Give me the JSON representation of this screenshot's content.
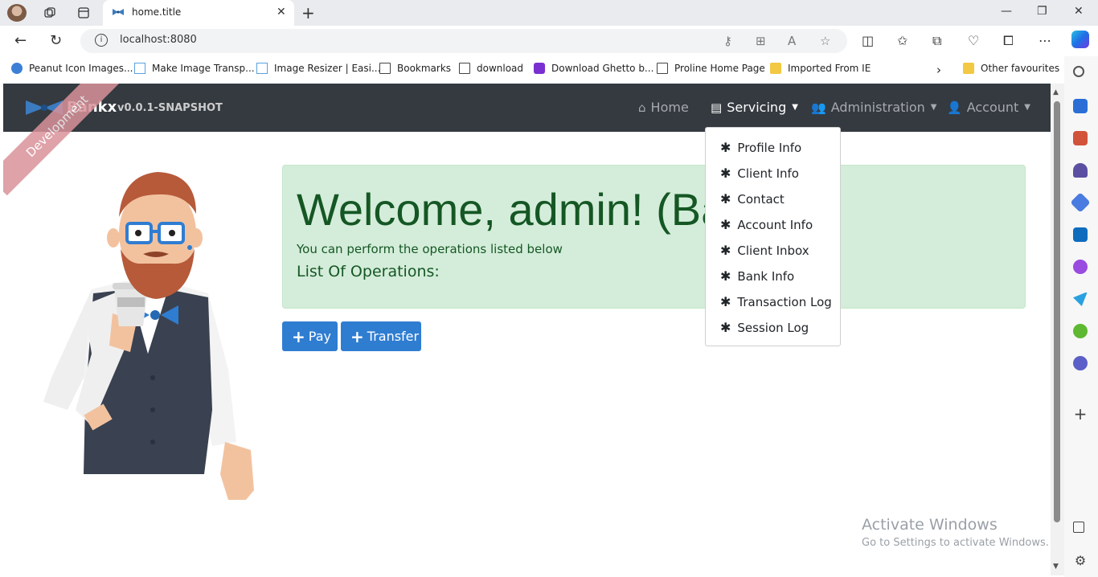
{
  "browser": {
    "tab_title": "home.title",
    "url": "localhost:8080",
    "bookmarks": [
      {
        "label": "Peanut Icon Images..."
      },
      {
        "label": "Make Image Transp..."
      },
      {
        "label": "Image Resizer | Easi..."
      },
      {
        "label": "Bookmarks"
      },
      {
        "label": "download"
      },
      {
        "label": "Download Ghetto b..."
      },
      {
        "label": "Proline Home Page"
      },
      {
        "label": "Imported From IE"
      },
      {
        "label": "Other favourites"
      }
    ]
  },
  "app": {
    "brand": "Bankx",
    "version": "v0.0.1-SNAPSHOT",
    "ribbon": "Development",
    "nav": {
      "home": "Home",
      "servicing": "Servicing",
      "administration": "Administration",
      "account": "Account"
    },
    "servicing_menu": [
      "Profile Info",
      "Client Info",
      "Contact",
      "Account Info",
      "Client Inbox",
      "Bank Info",
      "Transaction Log",
      "Session Log"
    ],
    "welcome_title": "Welcome, admin! (Bankx)",
    "lead": "You can perform the operations listed below",
    "operations_title": "List Of Operations:",
    "buttons": {
      "pay": "Pay",
      "transfer": "Transfer"
    }
  },
  "watermark": {
    "line1": "Activate Windows",
    "line2": "Go to Settings to activate Windows."
  },
  "colors": {
    "navbar": "#343a40",
    "jumbotron": "#d4edda",
    "primary_button": "#2f7dd1",
    "ribbon": "#d9929a"
  }
}
